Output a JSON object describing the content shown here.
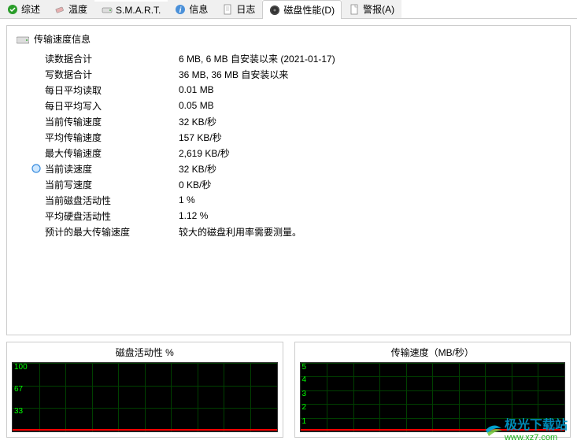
{
  "tabs": [
    {
      "id": "overview",
      "label": "综述"
    },
    {
      "id": "temperature",
      "label": "温度"
    },
    {
      "id": "smart",
      "label": "S.M.A.R.T."
    },
    {
      "id": "info",
      "label": "信息"
    },
    {
      "id": "log",
      "label": "日志"
    },
    {
      "id": "disk-perf",
      "label": "磁盘性能(D)"
    },
    {
      "id": "alarm",
      "label": "警报(A)"
    }
  ],
  "activeTab": 5,
  "section": {
    "title": "传输速度信息"
  },
  "rows": [
    {
      "label": "读数据合计",
      "value": "6 MB,  6 MB 自安装以来  (2021-01-17)",
      "marker": false
    },
    {
      "label": "写数据合计",
      "value": "36 MB,  36 MB 自安装以来",
      "marker": false
    },
    {
      "label": "每日平均读取",
      "value": "0.01 MB",
      "marker": false
    },
    {
      "label": "每日平均写入",
      "value": "0.05 MB",
      "marker": false
    },
    {
      "label": "当前传输速度",
      "value": "32 KB/秒",
      "marker": false
    },
    {
      "label": "平均传输速度",
      "value": "157 KB/秒",
      "marker": false
    },
    {
      "label": "最大传输速度",
      "value": "2,619 KB/秒",
      "marker": false
    },
    {
      "label": "当前读速度",
      "value": "32 KB/秒",
      "marker": true
    },
    {
      "label": "当前写速度",
      "value": "0 KB/秒",
      "marker": false
    },
    {
      "label": "当前磁盘活动性",
      "value": "1 %",
      "marker": false
    },
    {
      "label": "平均硬盘活动性",
      "value": "1.12 %",
      "marker": false
    },
    {
      "label": "预计的最大传输速度",
      "value": "较大的磁盘利用率需要测量。",
      "marker": false
    }
  ],
  "graphs": {
    "left": {
      "title": "磁盘活动性 %",
      "ticks": [
        "100",
        "67",
        "33"
      ]
    },
    "right": {
      "title": "传输速度（MB/秒）",
      "ticks": [
        "5",
        "4",
        "3",
        "2",
        "1"
      ]
    }
  },
  "watermark": {
    "brand": "极光下载站",
    "url": "www.xz7.com"
  },
  "chart_data": [
    {
      "type": "line",
      "title": "磁盘活动性 %",
      "ylabel": "%",
      "ylim": [
        0,
        100
      ],
      "yticks": [
        33,
        67,
        100
      ],
      "series": [
        {
          "name": "activity",
          "values": [
            1
          ]
        }
      ]
    },
    {
      "type": "line",
      "title": "传输速度（MB/秒）",
      "ylabel": "MB/秒",
      "ylim": [
        0,
        5
      ],
      "yticks": [
        1,
        2,
        3,
        4,
        5
      ],
      "series": [
        {
          "name": "transfer",
          "values": [
            0.03
          ]
        }
      ]
    }
  ]
}
